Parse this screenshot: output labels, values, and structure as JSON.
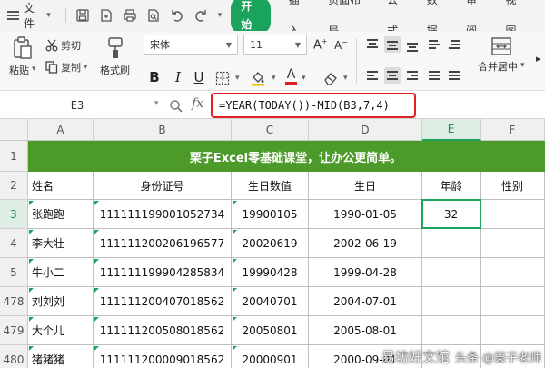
{
  "menubar": {
    "file_label": "文件",
    "tabs": [
      {
        "label": "开始",
        "active": true
      },
      {
        "label": "插入",
        "active": false
      },
      {
        "label": "页面布局",
        "active": false
      },
      {
        "label": "公式",
        "active": false
      },
      {
        "label": "数据",
        "active": false
      },
      {
        "label": "审阅",
        "active": false
      },
      {
        "label": "视图",
        "active": false
      }
    ]
  },
  "ribbon": {
    "paste_label": "粘贴",
    "cut_label": "剪切",
    "copy_label": "复制",
    "format_painter_label": "格式刷",
    "font_name": "宋体",
    "font_size": "11",
    "bold": "B",
    "italic": "I",
    "underline": "U",
    "font_color_letter": "A",
    "merge_label": "合并居中"
  },
  "formula_bar": {
    "name_box": "E3",
    "fx": "fx",
    "formula": "=YEAR(TODAY())-MID(B3,7,4)"
  },
  "sheet": {
    "columns": [
      "A",
      "B",
      "C",
      "D",
      "E",
      "F"
    ],
    "active_column": "E",
    "active_row": "3",
    "banner": "栗子Excel零基础课堂，让办公更简单。",
    "header_row": {
      "row": "2",
      "cells": [
        "姓名",
        "身份证号",
        "生日数值",
        "生日",
        "年龄",
        "性别"
      ]
    },
    "rows": [
      {
        "row": "3",
        "cells": [
          "张跑跑",
          "111111199001052734",
          "19900105",
          "1990-01-05",
          "32",
          ""
        ]
      },
      {
        "row": "4",
        "cells": [
          "李大壮",
          "111111200206196577",
          "20020619",
          "2002-06-19",
          "",
          ""
        ]
      },
      {
        "row": "5",
        "cells": [
          "牛小二",
          "111111199904285834",
          "19990428",
          "1999-04-28",
          "",
          ""
        ]
      },
      {
        "row": "478",
        "cells": [
          "刘刘刘",
          "111111200407018562",
          "20040701",
          "2004-07-01",
          "",
          ""
        ]
      },
      {
        "row": "479",
        "cells": [
          "大个儿",
          "111111200508018562",
          "20050801",
          "2005-08-01",
          "",
          ""
        ]
      },
      {
        "row": "480",
        "cells": [
          "猪猪猪",
          "111111200009018562",
          "20000901",
          "2000-09-01",
          "",
          ""
        ]
      }
    ],
    "banner_row": "1"
  },
  "watermark": {
    "main": "易坊好文馆",
    "sub": "头条 @栗子老师"
  },
  "colors": {
    "accent": "#1aa35a",
    "banner": "#4c9a2a",
    "formula_highlight": "#e02020"
  }
}
